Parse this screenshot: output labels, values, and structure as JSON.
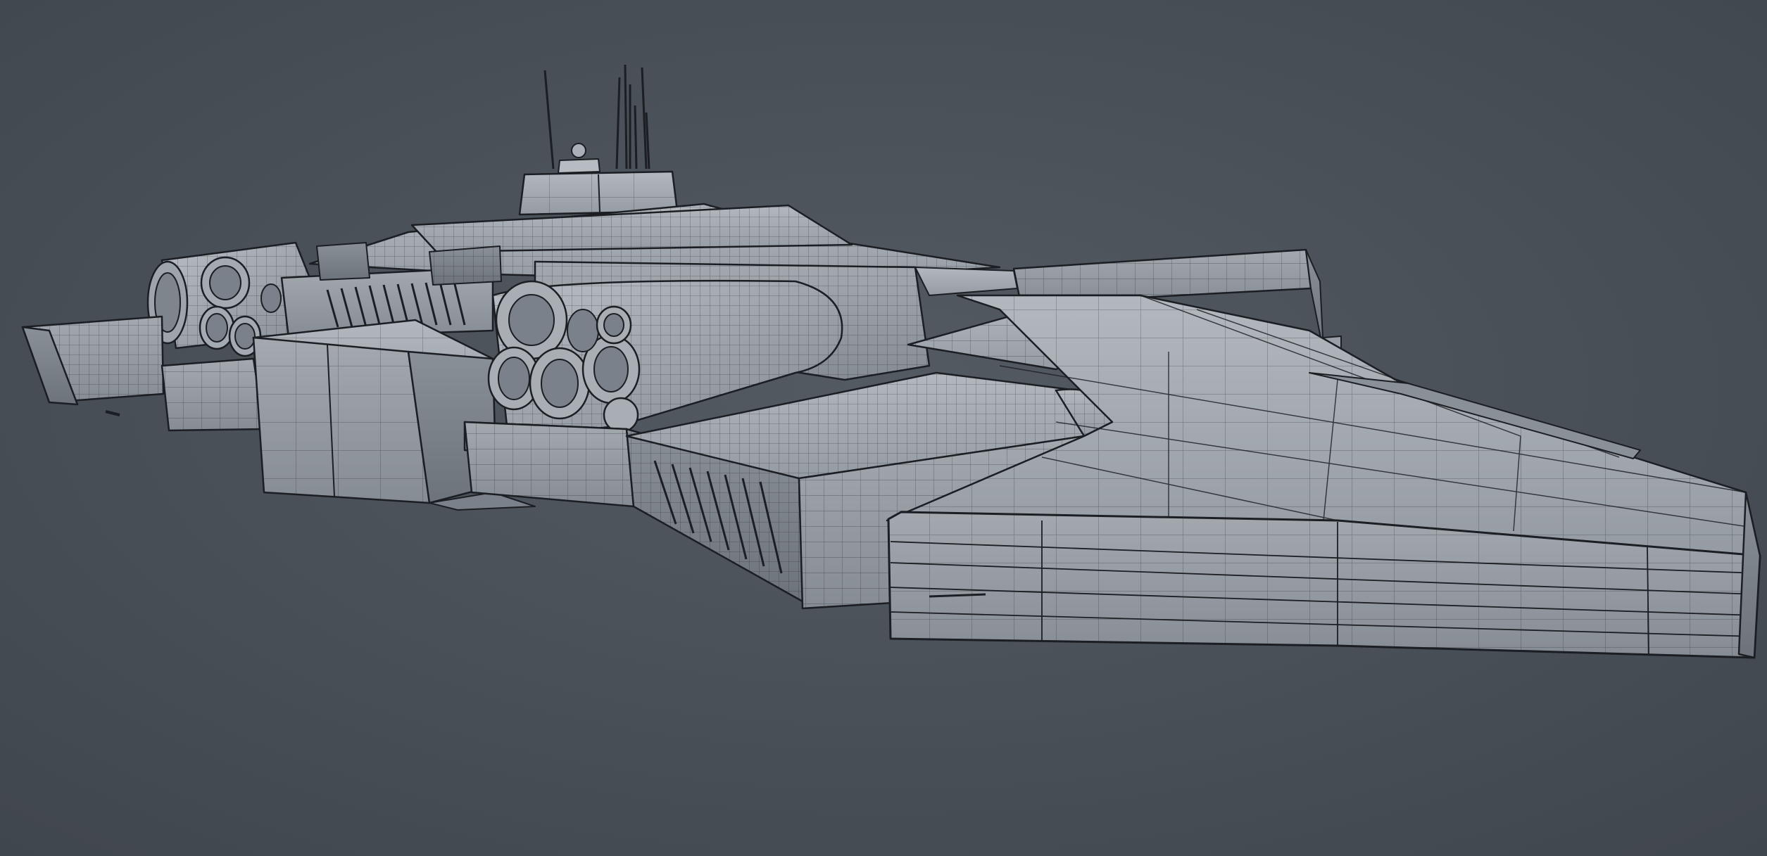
{
  "scene": {
    "subject": "spaceship-wireframe-render",
    "background_color": "#4a5057",
    "hull_color": "#9aa0a8",
    "hull_light_color": "#aeb3ba",
    "hull_dark_color": "#7b818a",
    "wire_color": "#1b1e22",
    "show_wireframe": true,
    "view": "perspective"
  }
}
